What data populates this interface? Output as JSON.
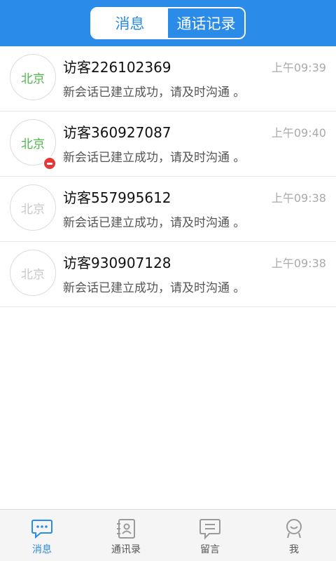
{
  "header": {
    "tabs": [
      {
        "label": "消息",
        "active": true
      },
      {
        "label": "通话记录",
        "active": false
      }
    ]
  },
  "conversations": [
    {
      "avatar_label": "北京",
      "name": "访客226102369",
      "time": "上午09:39",
      "message": "新会话已建立成功，请及时沟通 。",
      "online": true,
      "badge": false
    },
    {
      "avatar_label": "北京",
      "name": "访客360927087",
      "time": "上午09:40",
      "message": "新会话已建立成功，请及时沟通 。",
      "online": true,
      "badge": true
    },
    {
      "avatar_label": "北京",
      "name": "访客557995612",
      "time": "上午09:38",
      "message": "新会话已建立成功，请及时沟通 。",
      "online": false,
      "badge": false
    },
    {
      "avatar_label": "北京",
      "name": "访客930907128",
      "time": "上午09:38",
      "message": "新会话已建立成功，请及时沟通 。",
      "online": false,
      "badge": false
    }
  ],
  "tabbar": {
    "items": [
      {
        "label": "消息",
        "icon": "chat-bubble-icon",
        "active": true
      },
      {
        "label": "通讯录",
        "icon": "contacts-icon",
        "active": false
      },
      {
        "label": "留言",
        "icon": "message-note-icon",
        "active": false
      },
      {
        "label": "我",
        "icon": "profile-icon",
        "active": false
      }
    ]
  },
  "colors": {
    "accent": "#2a8be8",
    "online": "#4cb848",
    "offline": "#c8c8c8",
    "badge": "#e53838"
  }
}
